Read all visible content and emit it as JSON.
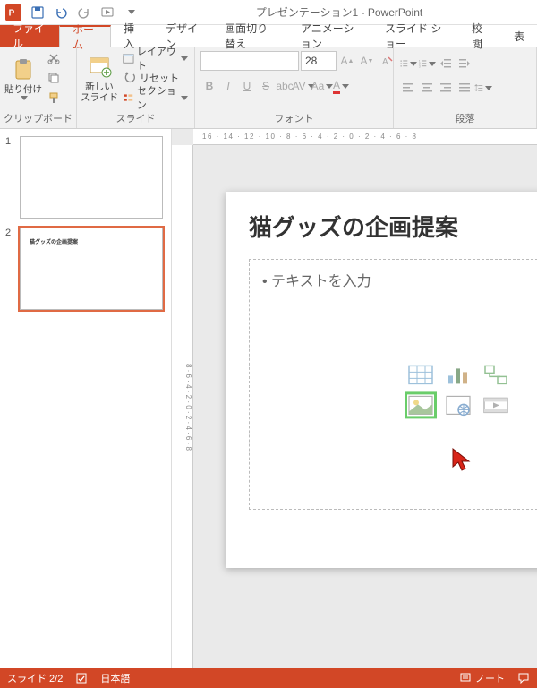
{
  "title": "プレゼンテーション1 - PowerPoint",
  "tabs": {
    "file": "ファイル",
    "home": "ホーム",
    "insert": "挿入",
    "design": "デザイン",
    "transitions": "画面切り替え",
    "animations": "アニメーション",
    "slideshow": "スライド ショー",
    "review": "校閲",
    "view": "表"
  },
  "ribbon": {
    "clipboard": {
      "label": "クリップボード",
      "paste": "貼り付け"
    },
    "slides": {
      "label": "スライド",
      "newslide": "新しい\nスライド",
      "layout": "レイアウト",
      "reset": "リセット",
      "section": "セクション"
    },
    "font": {
      "label": "フォント",
      "name_placeholder": "",
      "size": "28"
    },
    "paragraph": {
      "label": "段落"
    }
  },
  "thumbs": {
    "n1": "1",
    "n2": "2",
    "t2_title": "猫グッズの企画提案"
  },
  "slide": {
    "title": "猫グッズの企画提案",
    "bullet": "テキストを入力"
  },
  "ruler": "16 · 14 · 12 · 10 · 8 · 6 · 4 · 2 · 0 · 2 · 4 · 6 · 8",
  "status": {
    "slide": "スライド 2/2",
    "lang": "日本語",
    "notes": "ノート"
  }
}
